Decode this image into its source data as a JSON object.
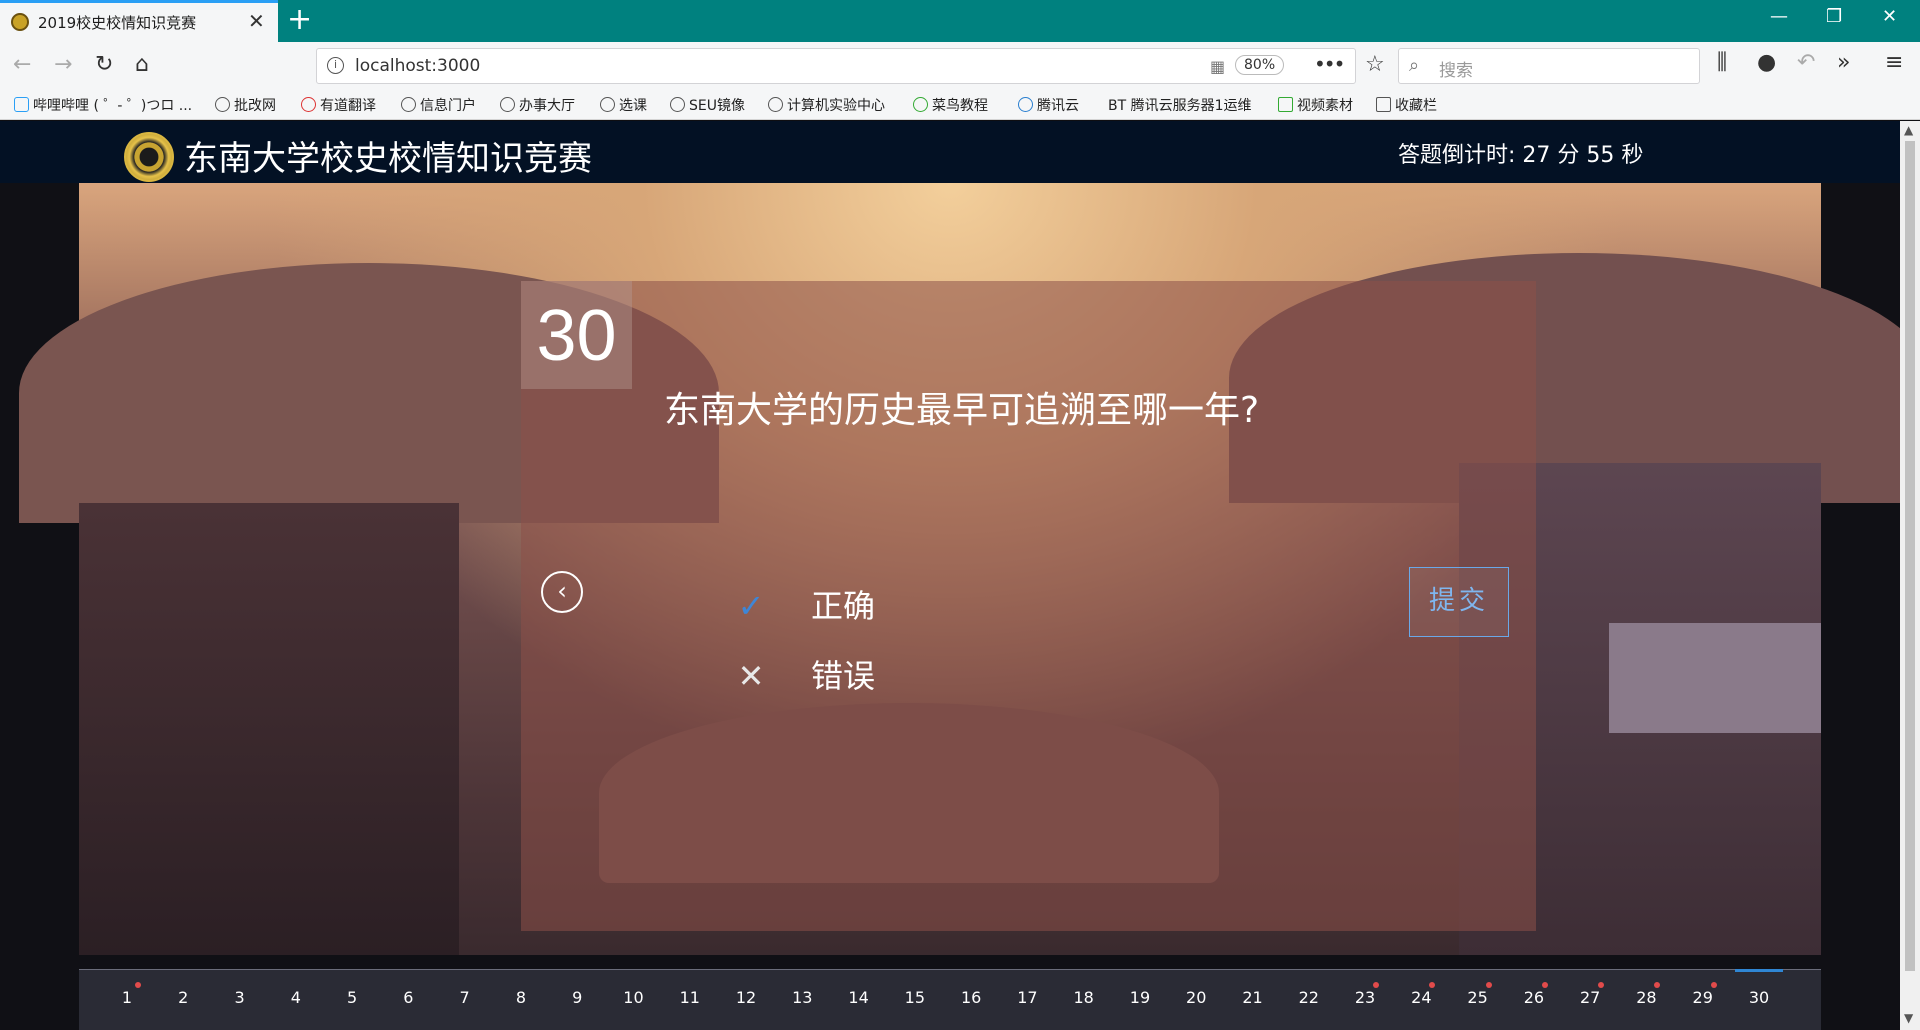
{
  "browser": {
    "tab_title": "2019校史校情知识竞赛",
    "url": "localhost:3000",
    "zoom": "80%",
    "search_placeholder": "搜索",
    "bookmarks": [
      "哔哩哔哩 ( ゜- ゜)つロ ...",
      "批改网",
      "有道翻译",
      "信息门户",
      "办事大厅",
      "选课",
      "SEU镜像",
      "计算机实验中心",
      "菜鸟教程",
      "腾讯云",
      "BT 腾讯云服务器1运维",
      "视频素材",
      "收藏栏"
    ]
  },
  "header": {
    "title": "东南大学校史校情知识竞赛",
    "countdown": "答题倒计时: 27 分 55 秒"
  },
  "question": {
    "number": "30",
    "text": "东南大学的历史最早可追溯至哪一年?",
    "options": [
      {
        "icon": "checkmark-icon",
        "label": "正确"
      },
      {
        "icon": "cross-icon",
        "label": "错误"
      }
    ],
    "submit_label": "提交"
  },
  "question_nav": {
    "items": [
      "1",
      "2",
      "3",
      "4",
      "5",
      "6",
      "7",
      "8",
      "9",
      "10",
      "11",
      "12",
      "13",
      "14",
      "15",
      "16",
      "17",
      "18",
      "19",
      "20",
      "21",
      "22",
      "23",
      "24",
      "25",
      "26",
      "27",
      "28",
      "29",
      "30"
    ],
    "marked": [
      "1",
      "23",
      "24",
      "25",
      "26",
      "27",
      "28",
      "29"
    ],
    "active": "30"
  },
  "colors": {
    "header_bg": "#031124",
    "submit_accent": "#6aa8e8",
    "marker_red": "#e24b4b",
    "active_blue": "#2f86d4"
  }
}
